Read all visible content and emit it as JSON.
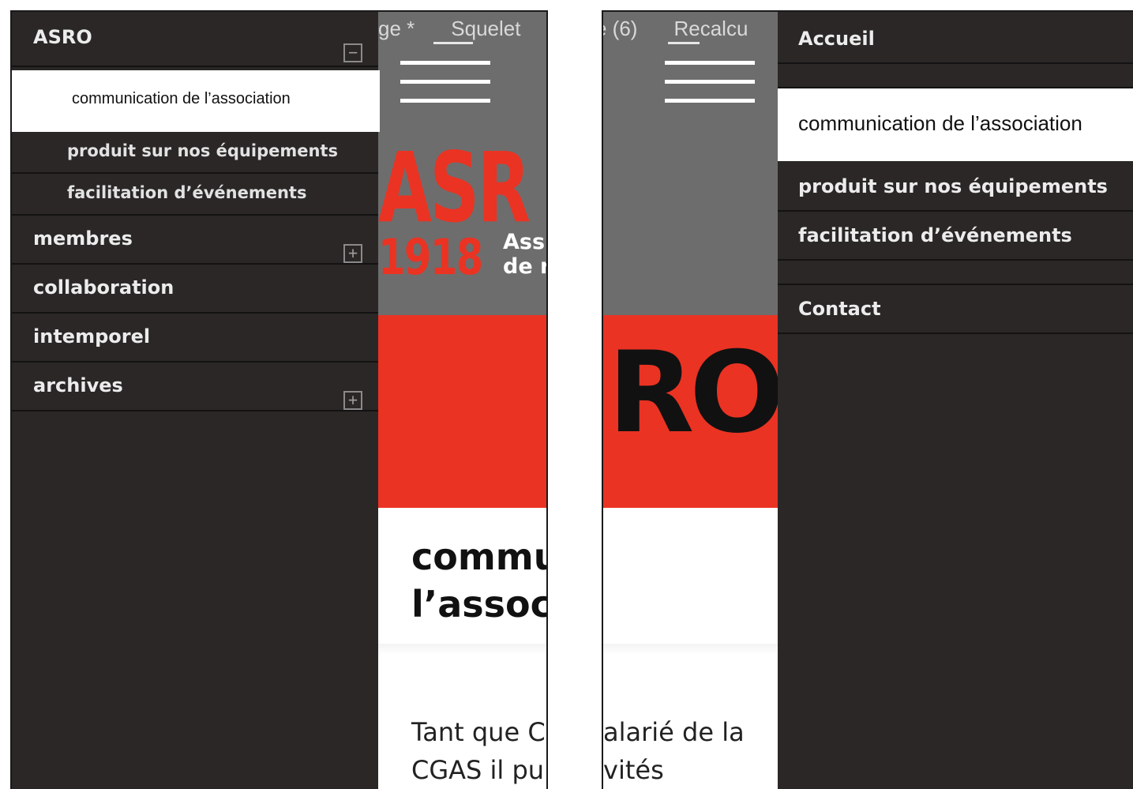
{
  "left_panel": {
    "tabs": [
      "ge *",
      "Squelet"
    ],
    "headline": [
      "commu",
      "l’assoc"
    ],
    "body": [
      "Tant que C",
      "CGAS il pu"
    ],
    "logo": {
      "main": "ASR",
      "year": "1918",
      "sub_line1": "Ass",
      "sub_line2": "de r"
    },
    "menu": {
      "items": [
        {
          "label": "ASRO",
          "toggle": "−"
        },
        {
          "label": "produit sur nos équipements"
        },
        {
          "label": "facilitation d’événements"
        },
        {
          "label": "membres",
          "toggle": "+"
        },
        {
          "label": "collaboration"
        },
        {
          "label": "intemporel"
        },
        {
          "label": "archives",
          "toggle": "+"
        }
      ],
      "highlighted": "communication de l’association"
    }
  },
  "right_panel": {
    "tabs": [
      "e (6)",
      "Recalcu"
    ],
    "big_logo": "RO",
    "body": [
      "alarié de la",
      "vités"
    ],
    "menu": {
      "items": [
        {
          "label": "Accueil"
        },
        {
          "label": "produit sur nos équipements"
        },
        {
          "label": "facilitation d’événements"
        },
        {
          "label": "Contact"
        }
      ],
      "highlighted": "communication de l’association"
    }
  },
  "colors": {
    "menu_bg": "#2a2726",
    "accent_red": "#ea3323",
    "header_gray": "#6e6d6d",
    "highlight_bg": "#ffffff"
  }
}
